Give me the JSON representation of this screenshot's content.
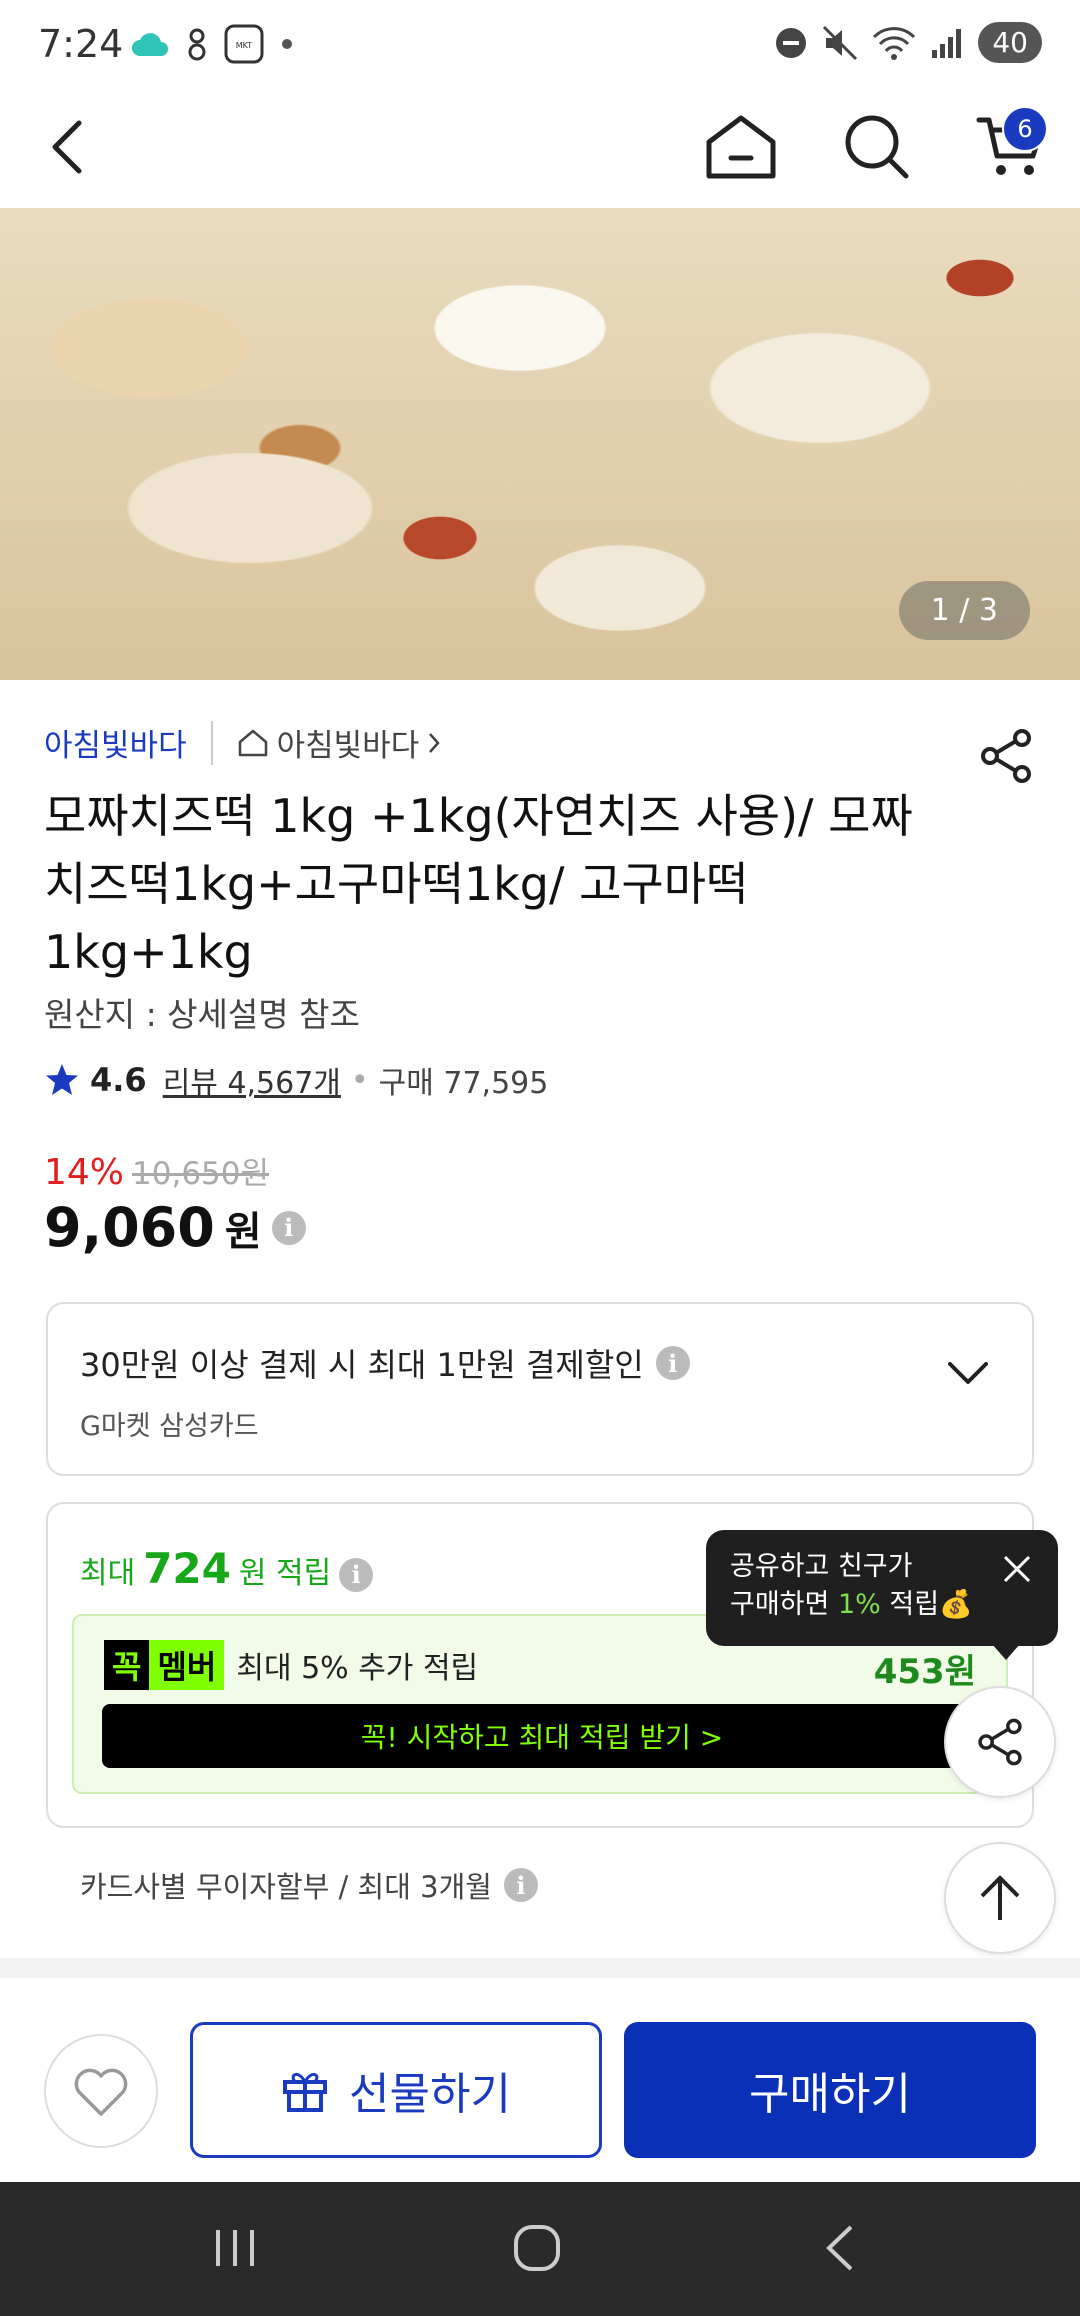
{
  "status_bar": {
    "time": "7:24",
    "battery": "40",
    "icons": [
      "cloud-icon",
      "bluetooth-alt-icon",
      "market-app-icon",
      "dot-icon",
      "dnd-icon",
      "mute-icon",
      "wifi-icon",
      "signal-icon"
    ]
  },
  "nav": {
    "cart_count": "6",
    "icons": [
      "back-arrow-icon",
      "home-icon",
      "search-icon",
      "cart-icon"
    ]
  },
  "hero": {
    "counter": "1 / 3"
  },
  "product": {
    "seller": "아침빛바다",
    "store_link": "아침빛바다",
    "title": "모짜치즈떡 1kg +1kg(자연치즈 사용)/ 모짜치즈떡1kg+고구마떡1kg/ 고구마떡1kg+1kg",
    "origin": "원산지 : 상세설명 참조",
    "rating": "4.6",
    "reviews": "리뷰 4,567개",
    "purchases": "구매 77,595",
    "discount": "14%",
    "original_price": "10,650원",
    "price": "9,060",
    "price_unit": "원"
  },
  "card_offer": {
    "title": "30만원 이상 결제 시 최대 1만원 결제할인",
    "card": "G마켓 삼성카드"
  },
  "reward": {
    "prefix": "최대",
    "amount": "724",
    "suffix": "원 적립",
    "member_logo_a": "꼭",
    "member_logo_b": "멤버",
    "member_text": "최대 5% 추가 적립",
    "member_amount": "453원",
    "cta": "꼭! 시작하고 최대 적립 받기 >"
  },
  "installment": "카드사별 무이자할부 / 최대 3개월",
  "tooltip": {
    "line1": "공유하고 친구가",
    "line2_a": "구매하면 ",
    "line2_green": "1%",
    "line2_b": " 적립💰"
  },
  "actions": {
    "gift": "선물하기",
    "buy": "구매하기"
  },
  "colors": {
    "brand_blue": "#0a30b8",
    "reward_green": "#17a81a",
    "discount_red": "#e02020",
    "member_lime": "#7fff00"
  }
}
